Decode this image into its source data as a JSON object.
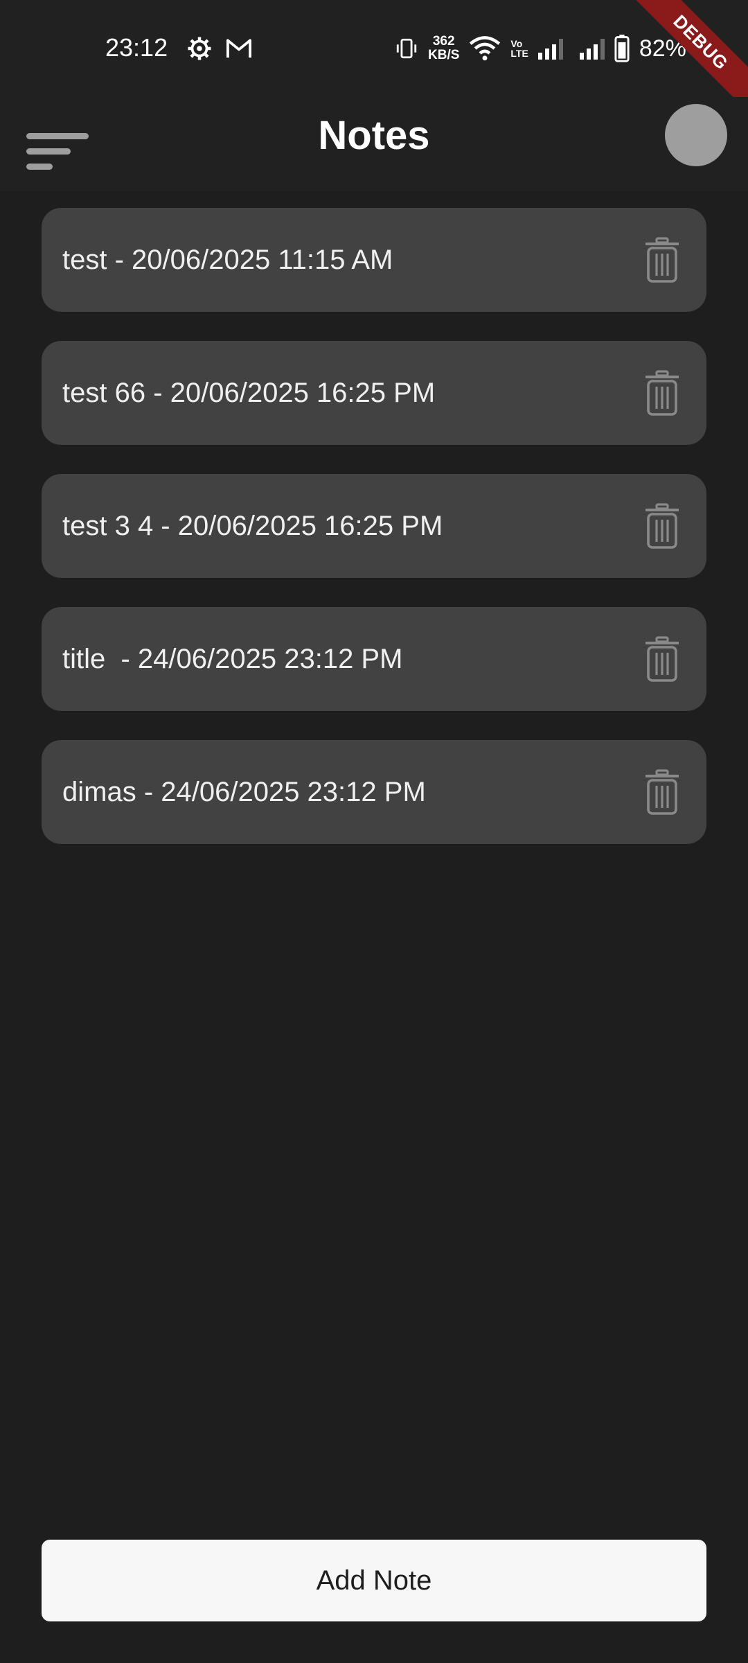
{
  "status_bar": {
    "time": "23:12",
    "net_speed_value": "362",
    "net_speed_unit": "KB/S",
    "volte_top": "Vo",
    "volte_bottom": "LTE",
    "battery_percent": "82%",
    "icons": [
      "settings-gear-icon",
      "gmail-icon",
      "vibrate-icon",
      "wifi-icon",
      "signal-icon",
      "signal-icon",
      "battery-icon"
    ]
  },
  "debug_banner": "DEBUG",
  "app_bar": {
    "title": "Notes",
    "menu_icon": "menu-icon",
    "avatar_color": "#9e9e9e"
  },
  "notes": [
    {
      "text": "test - 20/06/2025 11:15 AM"
    },
    {
      "text": "test 66 - 20/06/2025 16:25 PM"
    },
    {
      "text": "test 3 4 - 20/06/2025 16:25 PM"
    },
    {
      "text": "title  - 24/06/2025 23:12 PM"
    },
    {
      "text": "dimas - 24/06/2025 23:12 PM"
    }
  ],
  "add_button": {
    "label": "Add Note"
  },
  "colors": {
    "background": "#1e1e1e",
    "card": "#424242",
    "button": "#f7f7f7",
    "debug_ribbon": "#8b1a1a"
  }
}
